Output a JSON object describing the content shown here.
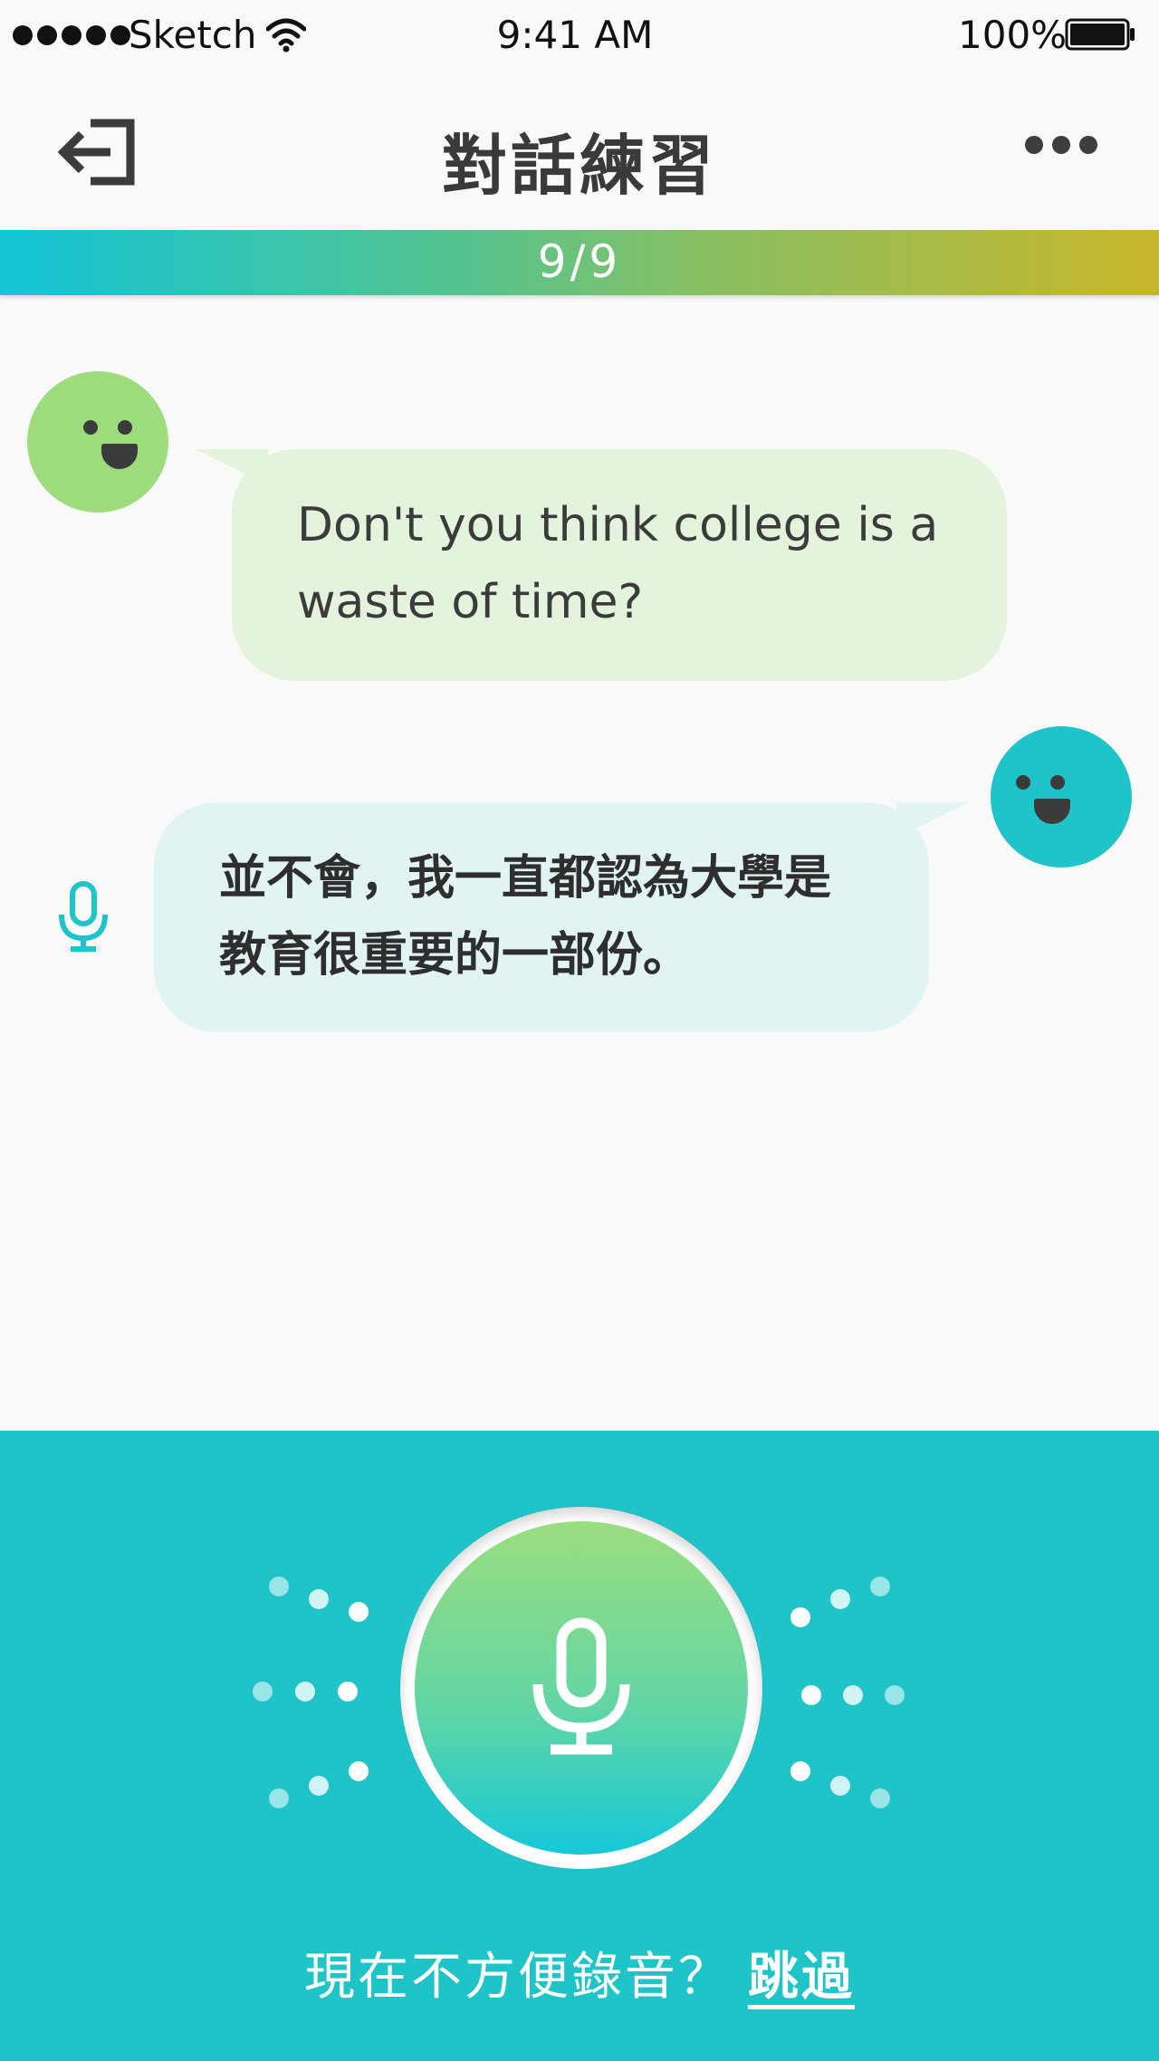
{
  "status_bar": {
    "carrier": "Sketch",
    "time": "9:41 AM",
    "battery": "100%",
    "icons": [
      "signal-icon",
      "wifi-icon",
      "battery-icon"
    ]
  },
  "header": {
    "title": "對話練習",
    "back_icon": "exit-icon",
    "more_icon": "more-icon"
  },
  "progress": {
    "label": "9/9",
    "current": 9,
    "total": 9,
    "colors": {
      "start": "#12c5d8",
      "mid": "#87c064",
      "end": "#c8b62a"
    }
  },
  "conversation": [
    {
      "speaker": "bot",
      "text": "Don't you think college is a waste of time?",
      "avatar_color": "#9ddc7c",
      "bubble_color": "#e3f3dc"
    },
    {
      "speaker": "user",
      "text": "並不會，我一直都認為大學是教育很重要的一部份。",
      "avatar_color": "#1ec4c8",
      "bubble_color": "#e2f3f3",
      "side_icon": "microphone-icon"
    }
  ],
  "record_panel": {
    "background": "#1ec4c8",
    "record_icon": "microphone-icon",
    "hint": "現在不方便錄音？",
    "skip_label": "跳過"
  }
}
